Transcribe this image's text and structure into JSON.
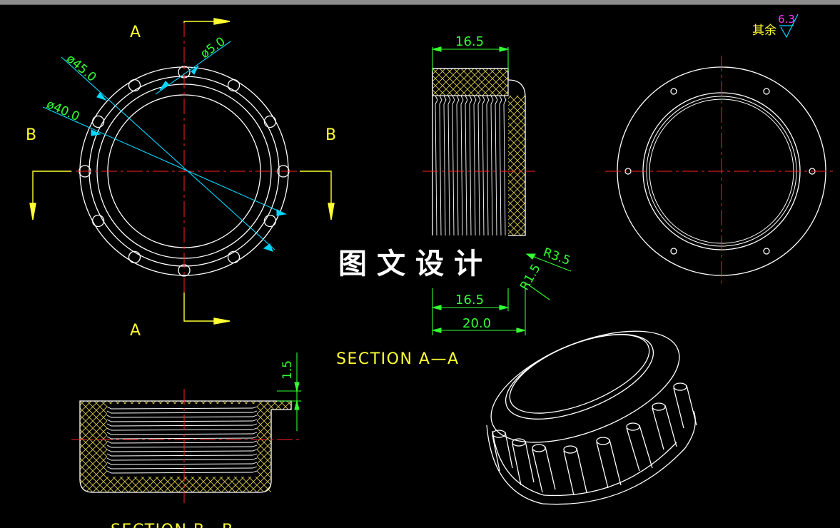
{
  "view_labels": {
    "a_top": "A",
    "a_bottom": "A",
    "b_left": "B",
    "b_right": "B"
  },
  "dimensions": {
    "d45": "ø45.0",
    "d40": "ø40.0",
    "d5": "ø5.0",
    "w_top": "16.5",
    "w_bottom": "16.5",
    "w_total": "20.0",
    "r35": "R3.5",
    "r15": "R1.5",
    "h15": "1.5"
  },
  "section_labels": {
    "aa": "SECTION A—A",
    "bb": "SECTION B—B"
  },
  "roughness": {
    "label": "其余",
    "value": "6.3"
  },
  "watermark": "图文设计",
  "colors": {
    "background": "#000000",
    "outline": "#ffffff",
    "center_line": "#ff2020",
    "section_arrow": "#ffff33",
    "dimension": "#33ff33",
    "leader": "#00d8ff",
    "hatch": "#d9c94a",
    "roughness_value": "#ff33ff"
  }
}
